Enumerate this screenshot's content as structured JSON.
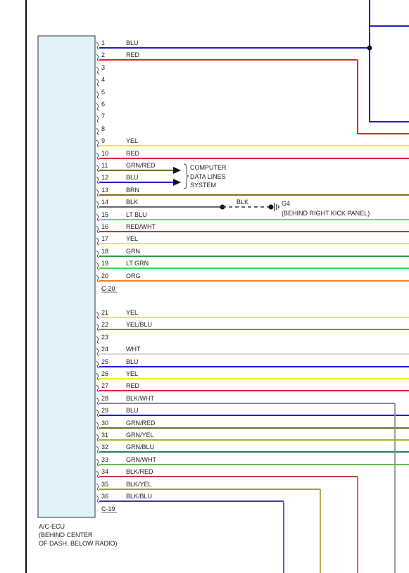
{
  "diagram": {
    "component": {
      "name": "A/C-ECU",
      "location_line1": "(BEHIND CENTER",
      "location_line2": "OF DASH, BELOW RADIO)"
    },
    "connector_c20": {
      "label": "C-20"
    },
    "connector_c19": {
      "label": "C-19"
    },
    "computer_data_lines": {
      "line1": "COMPUTER",
      "line2": "DATA LINES",
      "line3": "SYSTEM"
    },
    "ground": {
      "wire_label": "BLK",
      "name": "G4",
      "location": "(BEHIND RIGHT KICK PANEL)"
    },
    "pins": [
      {
        "num": "1",
        "wire": "BLU",
        "color": "#1c1cd6"
      },
      {
        "num": "2",
        "wire": "RED",
        "color": "#e8202a"
      },
      {
        "num": "3",
        "wire": "",
        "color": ""
      },
      {
        "num": "4",
        "wire": "",
        "color": ""
      },
      {
        "num": "5",
        "wire": "",
        "color": ""
      },
      {
        "num": "6",
        "wire": "",
        "color": ""
      },
      {
        "num": "7",
        "wire": "",
        "color": ""
      },
      {
        "num": "8",
        "wire": "",
        "color": ""
      },
      {
        "num": "9",
        "wire": "YEL",
        "color": "#f2ec1f"
      },
      {
        "num": "10",
        "wire": "RED",
        "color": "#e8202a"
      },
      {
        "num": "11",
        "wire": "GRN/RED",
        "color": "#7a6a12"
      },
      {
        "num": "12",
        "wire": "BLU",
        "color": "#1c1cd6"
      },
      {
        "num": "13",
        "wire": "BRN",
        "color": "#8b6a14"
      },
      {
        "num": "14",
        "wire": "BLK",
        "color": "#333333"
      },
      {
        "num": "15",
        "wire": "LT BLU",
        "color": "#2fd8f0"
      },
      {
        "num": "16",
        "wire": "RED/WHT",
        "color": "#e8202a"
      },
      {
        "num": "17",
        "wire": "YEL",
        "color": "#f2ec1f"
      },
      {
        "num": "18",
        "wire": "GRN",
        "color": "#23a13a"
      },
      {
        "num": "19",
        "wire": "LT GRN",
        "color": "#33e03d"
      },
      {
        "num": "20",
        "wire": "ORG",
        "color": "#f57d1f"
      },
      {
        "num": "21",
        "wire": "YEL",
        "color": "#f2ec1f"
      },
      {
        "num": "22",
        "wire": "YEL/BLU",
        "color": "#8e8a1a"
      },
      {
        "num": "23",
        "wire": "",
        "color": ""
      },
      {
        "num": "24",
        "wire": "WHT",
        "color": "#d6d6d6"
      },
      {
        "num": "25",
        "wire": "BLU",
        "color": "#1c1cd6"
      },
      {
        "num": "26",
        "wire": "YEL",
        "color": "#f2ec1f"
      },
      {
        "num": "27",
        "wire": "RED",
        "color": "#e8202a"
      },
      {
        "num": "28",
        "wire": "BLK/WHT",
        "color": "#888888"
      },
      {
        "num": "29",
        "wire": "BLU",
        "color": "#1c1cd6"
      },
      {
        "num": "30",
        "wire": "GRN/RED",
        "color": "#5f7a18"
      },
      {
        "num": "31",
        "wire": "GRN/YEL",
        "color": "#9ac21a"
      },
      {
        "num": "32",
        "wire": "GRN/BLU",
        "color": "#2b7a6a"
      },
      {
        "num": "33",
        "wire": "GRN/WHT",
        "color": "#6ab84a"
      },
      {
        "num": "34",
        "wire": "BLK/RED",
        "color": "#c23a3a"
      },
      {
        "num": "35",
        "wire": "BLK/YEL",
        "color": "#a39a2e"
      },
      {
        "num": "36",
        "wire": "BLK/BLU",
        "color": "#3a3a9a"
      }
    ]
  }
}
